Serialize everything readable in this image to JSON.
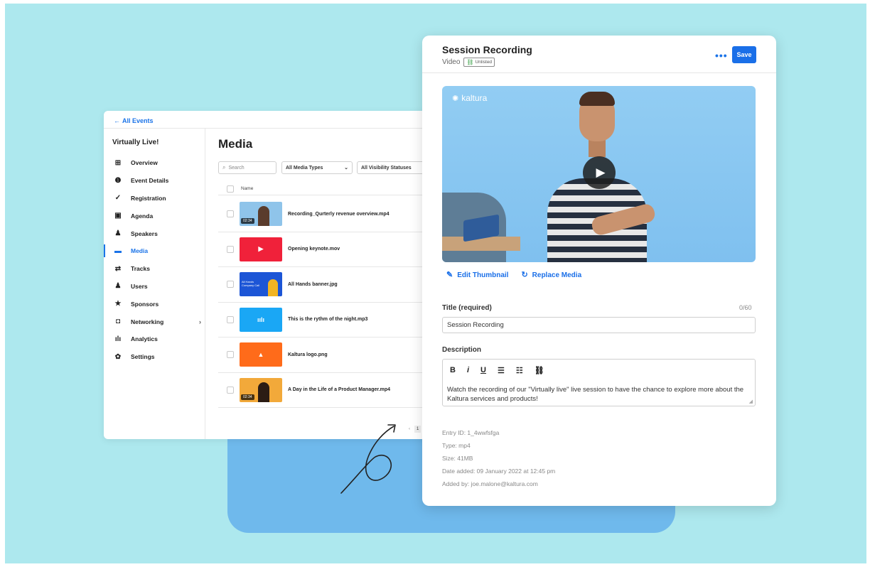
{
  "left": {
    "back_link": "All Events",
    "event_name": "Virtually Live!",
    "nav": [
      {
        "label": "Overview",
        "icon": "grid-icon",
        "glyph": "⊞"
      },
      {
        "label": "Event Details",
        "icon": "info-icon",
        "glyph": "❶"
      },
      {
        "label": "Registration",
        "icon": "check-icon",
        "glyph": "✓"
      },
      {
        "label": "Agenda",
        "icon": "calendar-icon",
        "glyph": "▣"
      },
      {
        "label": "Speakers",
        "icon": "speaker-icon",
        "glyph": "♟"
      },
      {
        "label": "Media",
        "icon": "folder-icon",
        "glyph": "▬"
      },
      {
        "label": "Tracks",
        "icon": "tracks-icon",
        "glyph": "⇄"
      },
      {
        "label": "Users",
        "icon": "user-icon",
        "glyph": "♟"
      },
      {
        "label": "Sponsors",
        "icon": "star-icon",
        "glyph": "★"
      },
      {
        "label": "Networking",
        "icon": "chat-icon",
        "glyph": "◘"
      },
      {
        "label": "Analytics",
        "icon": "analytics-icon",
        "glyph": "ılı"
      },
      {
        "label": "Settings",
        "icon": "gear-icon",
        "glyph": "✿"
      }
    ],
    "media_title": "Media",
    "search_placeholder": "Search",
    "filter_types": "All Media Types",
    "filter_visibility": "All Visibility Statuses",
    "col_name": "Name",
    "rows": [
      {
        "name": "Recording_Qurterly revenue overview.mp4",
        "duration": "02:34"
      },
      {
        "name": "Opening keynote.mov"
      },
      {
        "name": "All Hands banner.jpg",
        "banner_text": "All Hands Company Call"
      },
      {
        "name": "This is the rythm of the night.mp3"
      },
      {
        "name": "Kaltura logo.png"
      },
      {
        "name": "A Day in the Life of a Product Manager.mp4",
        "duration": "02:34"
      }
    ],
    "pager_prev": "‹",
    "pager_page": "1"
  },
  "panel": {
    "title": "Session Recording",
    "type": "Video",
    "badge": "Unlisted",
    "more": "•••",
    "save": "Save",
    "brand": "kaltura",
    "edit_thumbnail": "Edit Thumbnail",
    "replace_media": "Replace Media",
    "title_label": "Title (required)",
    "title_count": "0/60",
    "title_value": "Session Recording",
    "desc_label": "Description",
    "toolbar": {
      "bold": "B",
      "italic": "i",
      "underline": "U",
      "bullets": "☰",
      "numbers": "☷",
      "link": "🔗"
    },
    "desc_value": "Watch the recording of our \"Virtually live\" live session to have the chance to explore more about the Kaltura services and products!",
    "meta": [
      "Entry ID: 1_4wwfsfga",
      "Type: mp4",
      "Size: 41MB",
      "Date added: 09 January 2022 at 12:45 pm",
      "Added by: joe.malone@kaltura.com"
    ]
  },
  "colors": {
    "background": "#ade8ee",
    "accent": "#1a6fe8",
    "block": "#6fb9ec"
  }
}
